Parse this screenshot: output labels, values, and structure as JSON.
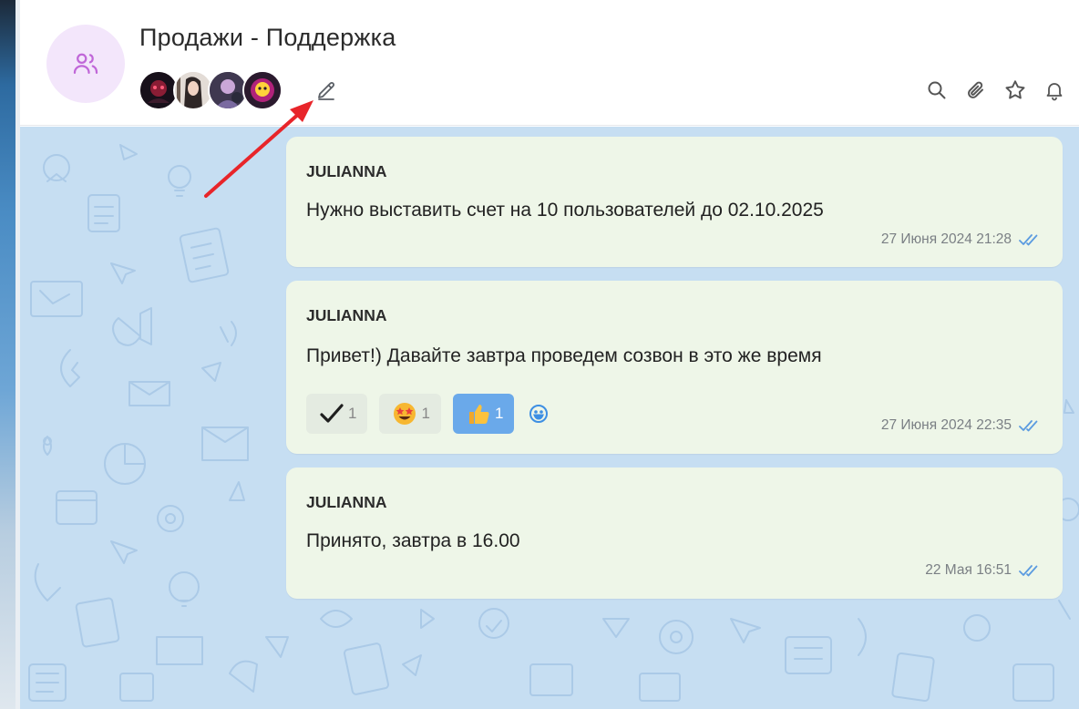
{
  "chat": {
    "title": "Продажи - Поддержка",
    "members": [
      {
        "name": "member-1",
        "color": "#1e1218",
        "accent": "#e0304f"
      },
      {
        "name": "member-2",
        "color": "#d8cfc8",
        "accent": "#3a2e2e"
      },
      {
        "name": "member-3",
        "color": "#3b3448",
        "accent": "#9a7fb7"
      },
      {
        "name": "member-4",
        "color": "#2a1a2a",
        "accent": "#ffd23a"
      }
    ],
    "header_icons": [
      "search-icon",
      "attachment-icon",
      "star-icon",
      "bell-icon"
    ]
  },
  "messages": [
    {
      "sender": "JULIANNA",
      "text": "Нужно выставить счет на 10 пользователей до 02.10.2025",
      "time": "27 Июня 2024 21:28"
    },
    {
      "sender": "JULIANNA",
      "text": "Привет!) Давайте завтра проведем созвон в это же время",
      "time": "27 Июня 2024 22:35",
      "reactions": [
        {
          "emoji": "check",
          "count": "1",
          "active": false
        },
        {
          "emoji": "star-struck",
          "count": "1",
          "active": false
        },
        {
          "emoji": "thumbs-up",
          "count": "1",
          "active": true
        }
      ]
    },
    {
      "sender": "JULIANNA",
      "text": "Принято, завтра в 16.00",
      "time": "22 Мая 16:51"
    }
  ],
  "colors": {
    "accent": "#6aa9ea",
    "bubble": "#eef6e8",
    "chat_bg": "#c6def2",
    "annotation_arrow": "#e8252a"
  }
}
